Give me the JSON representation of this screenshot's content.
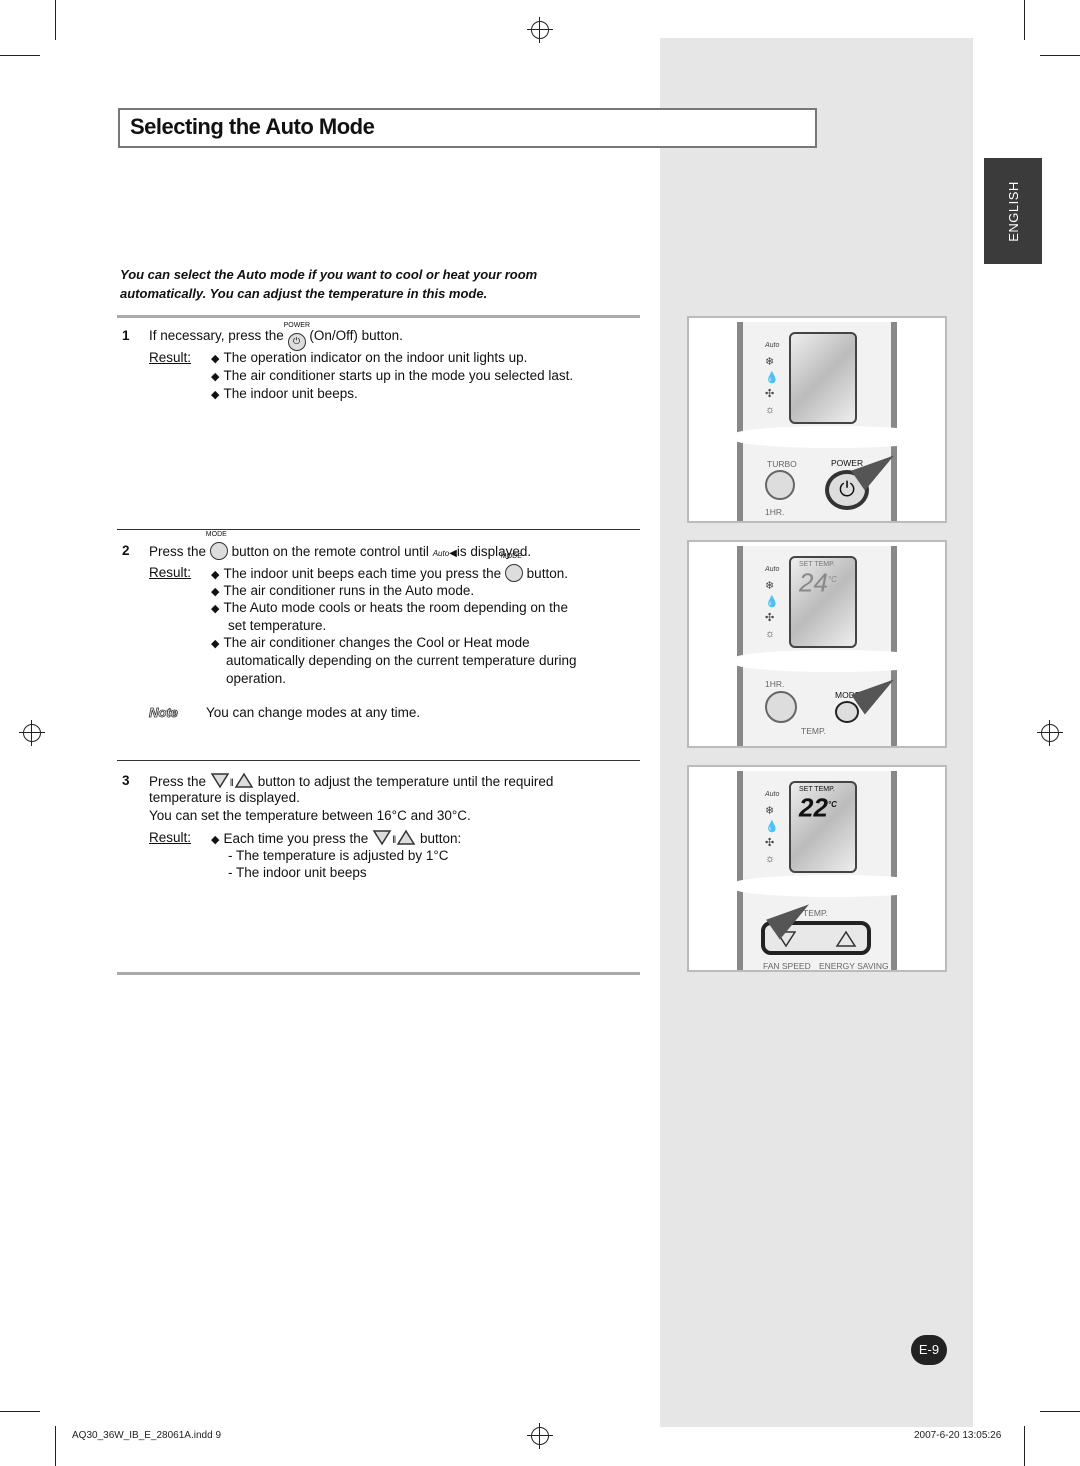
{
  "title": "Selecting the Auto Mode",
  "side_tab": "ENGLISH",
  "intro": "You can select the Auto mode if you want to cool or heat your room automatically. You can adjust the temperature in this mode.",
  "result_label": "Result:",
  "steps": [
    {
      "num": "1",
      "pre": "If necessary, press the",
      "button_label": "POWER",
      "post": "(On/Off) button.",
      "results": [
        "The operation indicator on the indoor unit lights up.",
        "The air conditioner starts up in the mode you selected last.",
        "The indoor unit beeps."
      ]
    },
    {
      "num": "2",
      "pre": "Press the",
      "button_label": "MODE",
      "mid": "button on the remote control until",
      "auto_icon": "Auto",
      "post": "is displayed.",
      "r1_pre": "The indoor unit beeps each time you press the",
      "r1_post": "button.",
      "results": [
        "The air conditioner runs in the Auto mode.",
        "The Auto mode cools or heats the room depending on the",
        "set temperature.",
        "The air conditioner changes the Cool or Heat mode",
        "automatically depending on the current temperature during",
        "operation."
      ],
      "note_label": "Note",
      "note": "You can change modes at any time."
    },
    {
      "num": "3",
      "pre": "Press the",
      "post": "button to adjust the temperature until the required",
      "line2": "temperature is displayed.",
      "line3": "You can set the temperature between 16°C and 30°C.",
      "r1_pre": "Each time you press the",
      "r1_post": "button:",
      "subs": [
        "- The temperature is adjusted by 1°C",
        "- The indoor unit beeps"
      ]
    }
  ],
  "remote": {
    "turbo": "TURBO",
    "power": "POWER",
    "onehr": "1HR.",
    "mode": "MODE",
    "temp": "TEMP.",
    "set_temp": "SET TEMP.",
    "temp2": "24",
    "temp3": "22",
    "unit": "°C",
    "fan_speed": "FAN SPEED",
    "energy_saving": "ENERGY SAVING",
    "auto": "Auto"
  },
  "page_number": "E-9",
  "footer": {
    "file": "AQ30_36W_IB_E_28061A.indd   9",
    "date": "2007-6-20   13:05:26"
  }
}
